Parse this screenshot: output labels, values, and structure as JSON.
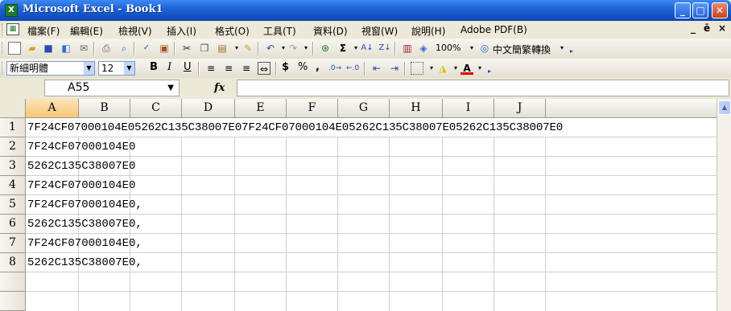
{
  "window": {
    "title": "Microsoft Excel - Book1",
    "app_icon": "excel-icon",
    "min_label": "_",
    "max_label": "□",
    "close_label": "✕"
  },
  "menubar": {
    "items": [
      "檔案(F)",
      "編輯(E)",
      "檢視(V)",
      "插入(I)",
      "格式(O)",
      "工具(T)",
      "資料(D)",
      "視窗(W)",
      "說明(H)",
      "Adobe PDF(B)"
    ],
    "doc_min": "_",
    "doc_restore": "ē",
    "doc_close": "×"
  },
  "toolbar": {
    "zoom": "100%",
    "translate_label": "中文簡繁轉換",
    "sigma": "Σ"
  },
  "format_toolbar": {
    "font_name": "新細明體",
    "font_size": "12",
    "bold": "B",
    "italic": "I",
    "underline": "U",
    "currency": "$",
    "percent": "%",
    "comma": ","
  },
  "formula_bar": {
    "name_box": "A55",
    "fx": "fx",
    "formula": ""
  },
  "sheet": {
    "columns": [
      "A",
      "B",
      "C",
      "D",
      "E",
      "F",
      "G",
      "H",
      "I",
      "J"
    ],
    "selected_column": "A",
    "rows": [
      {
        "num": "1",
        "a": "7F24CF07000104E05262C135C38007E07F24CF07000104E05262C135C38007E05262C135C38007E0"
      },
      {
        "num": "2",
        "a": "7F24CF07000104E0"
      },
      {
        "num": "3",
        "a": "5262C135C38007E0"
      },
      {
        "num": "4",
        "a": "7F24CF07000104E0"
      },
      {
        "num": "5",
        "a": "7F24CF07000104E0,"
      },
      {
        "num": "6",
        "a": "5262C135C38007E0,"
      },
      {
        "num": "7",
        "a": "7F24CF07000104E0,"
      },
      {
        "num": "8",
        "a": "5262C135C38007E0,"
      }
    ]
  }
}
